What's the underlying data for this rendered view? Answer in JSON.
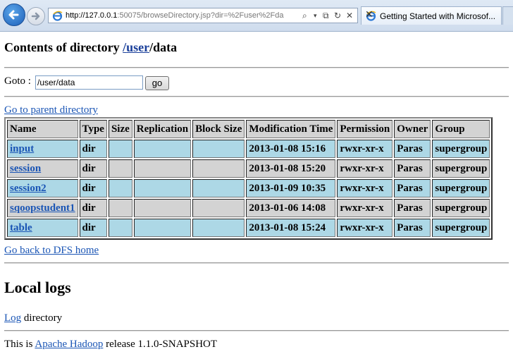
{
  "browser": {
    "address": {
      "url_host": "http://127.0.0.1",
      "url_rest": ":50075/browseDirectory.jsp?dir=%2Fuser%2Fda",
      "controls": [
        "⌕",
        "▾",
        "⧉",
        "↻",
        "✕"
      ]
    },
    "tab": {
      "title": "Getting Started with Microsof...",
      "close": "✕"
    }
  },
  "page": {
    "title_prefix": "Contents of directory ",
    "title_link_sep1": "/",
    "title_link_user": "user",
    "title_link_sep2": "/",
    "title_suffix": "data",
    "goto_label": "Goto : ",
    "goto_value": "/user/data",
    "go_button": "go",
    "parent_link": "Go to parent directory",
    "table": {
      "headers": [
        "Name",
        "Type",
        "Size",
        "Replication",
        "Block Size",
        "Modification Time",
        "Permission",
        "Owner",
        "Group"
      ],
      "rows": [
        {
          "name": "input",
          "type": "dir",
          "size": "",
          "replication": "",
          "block_size": "",
          "mtime": "2013-01-08 15:16",
          "permission": "rwxr-xr-x",
          "owner": "Paras",
          "group": "supergroup"
        },
        {
          "name": "session",
          "type": "dir",
          "size": "",
          "replication": "",
          "block_size": "",
          "mtime": "2013-01-08 15:20",
          "permission": "rwxr-xr-x",
          "owner": "Paras",
          "group": "supergroup"
        },
        {
          "name": "session2",
          "type": "dir",
          "size": "",
          "replication": "",
          "block_size": "",
          "mtime": "2013-01-09 10:35",
          "permission": "rwxr-xr-x",
          "owner": "Paras",
          "group": "supergroup"
        },
        {
          "name": "sqoopstudent1",
          "type": "dir",
          "size": "",
          "replication": "",
          "block_size": "",
          "mtime": "2013-01-06 14:08",
          "permission": "rwxr-xr-x",
          "owner": "Paras",
          "group": "supergroup"
        },
        {
          "name": "table",
          "type": "dir",
          "size": "",
          "replication": "",
          "block_size": "",
          "mtime": "2013-01-08 15:24",
          "permission": "rwxr-xr-x",
          "owner": "Paras",
          "group": "supergroup"
        }
      ]
    },
    "dfs_home_link": "Go back to DFS home",
    "local_logs_heading": "Local logs",
    "log_link": "Log",
    "log_suffix": " directory",
    "release_prefix": "This is ",
    "release_link": "Apache Hadoop",
    "release_suffix": " release 1.1.0-SNAPSHOT"
  },
  "colors": {
    "link": "#1a55b5",
    "row_blue": "#add8e6",
    "row_grey": "#d3d3d3"
  }
}
